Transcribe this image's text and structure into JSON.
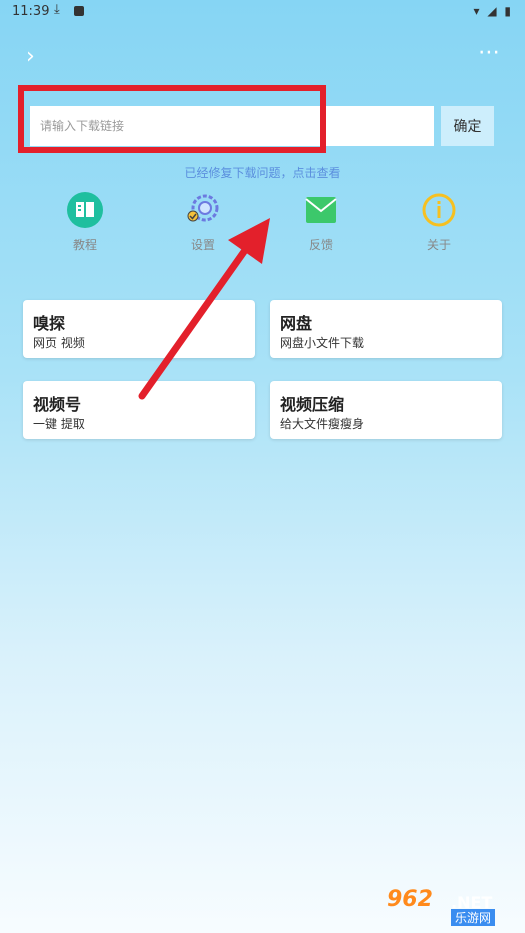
{
  "status": {
    "time": "11:39",
    "right": "▾ ◢ ▮"
  },
  "header": {
    "back_icon": "chevron-right-icon",
    "more_icon": "more-dots-icon"
  },
  "search": {
    "placeholder": "请输入下载链接",
    "value": "",
    "confirm_label": "确定"
  },
  "notice": "已经修复下载问题，点击查看",
  "tools": [
    {
      "label": "教程",
      "icon": "book-icon",
      "color": "#1fbf9f"
    },
    {
      "label": "设置",
      "icon": "gear-icon",
      "color": "#6c7ae0"
    },
    {
      "label": "反馈",
      "icon": "mail-icon",
      "color": "#3cc86b"
    },
    {
      "label": "关于",
      "icon": "info-icon",
      "color": "#f6c021"
    }
  ],
  "cards": [
    {
      "title": "嗅探",
      "subtitle": "网页 视频"
    },
    {
      "title": "网盘",
      "subtitle": "网盘小文件下载"
    },
    {
      "title": "视频号",
      "subtitle": "一键 提取"
    },
    {
      "title": "视频压缩",
      "subtitle": "给大文件瘦瘦身"
    }
  ],
  "watermark": {
    "num": "962",
    "net": ".NET",
    "sub": "乐游网"
  },
  "colors": {
    "highlight": "#e3202b",
    "notice": "#5b8fde"
  }
}
